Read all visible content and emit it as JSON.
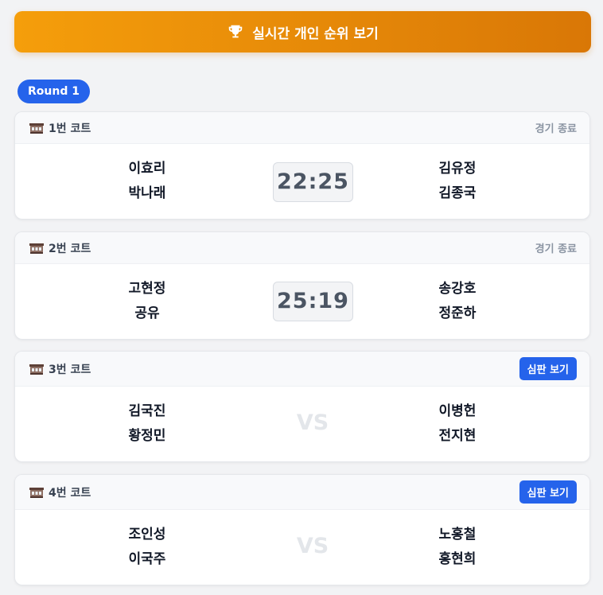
{
  "header": {
    "rank_label": "실시간 개인 순위 보기"
  },
  "round": {
    "label": "Round 1"
  },
  "matches": [
    {
      "court": "1번 코트",
      "status": "경기 종료",
      "team_a": [
        "이효리",
        "박나래"
      ],
      "team_b": [
        "김유정",
        "김종국"
      ],
      "score": "22:25"
    },
    {
      "court": "2번 코트",
      "status": "경기 종료",
      "team_a": [
        "고현정",
        "공유"
      ],
      "team_b": [
        "송강호",
        "정준하"
      ],
      "score": "25:19"
    },
    {
      "court": "3번 코트",
      "action": "심판 보기",
      "team_a": [
        "김국진",
        "황정민"
      ],
      "team_b": [
        "이병헌",
        "전지현"
      ],
      "vs": "VS"
    },
    {
      "court": "4번 코트",
      "action": "심판 보기",
      "team_a": [
        "조인성",
        "이국주"
      ],
      "team_b": [
        "노홍철",
        "홍현희"
      ],
      "vs": "VS"
    }
  ],
  "icons": {
    "rank": "trophy-icon",
    "court": "stadium-icon"
  },
  "colors": {
    "accent": "#f59e0b",
    "primary": "#2563eb"
  }
}
